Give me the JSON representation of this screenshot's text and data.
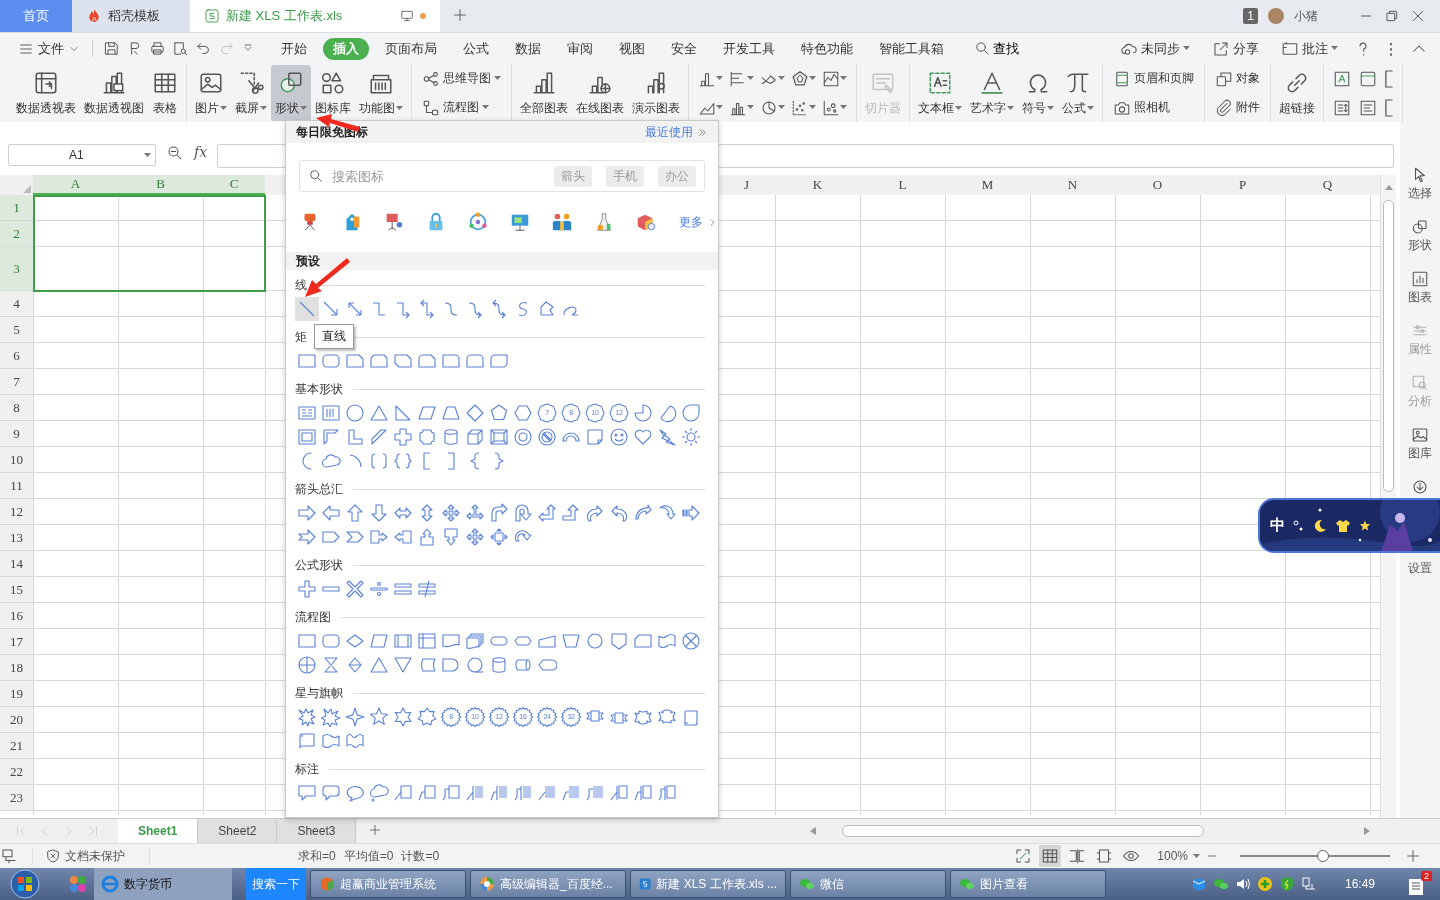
{
  "tabs": [
    {
      "label": "首页",
      "kind": "home",
      "selected": false
    },
    {
      "label": "稻壳模板",
      "kind": "docer",
      "selected": false
    },
    {
      "label": "新建 XLS 工作表.xls",
      "kind": "sheet",
      "selected": true
    }
  ],
  "account": {
    "count": "1",
    "name": "小猪"
  },
  "menu": {
    "file": "文件",
    "tabs": [
      {
        "label": "开始",
        "selected": false
      },
      {
        "label": "插入",
        "selected": true
      },
      {
        "label": "页面布局",
        "selected": false
      },
      {
        "label": "公式",
        "selected": false
      },
      {
        "label": "数据",
        "selected": false
      },
      {
        "label": "审阅",
        "selected": false
      },
      {
        "label": "视图",
        "selected": false
      },
      {
        "label": "安全",
        "selected": false
      },
      {
        "label": "开发工具",
        "selected": false
      },
      {
        "label": "特色功能",
        "selected": false
      },
      {
        "label": "智能工具箱",
        "selected": false
      }
    ],
    "search": "查找",
    "actions": [
      {
        "label": "未同步",
        "dropdown": true
      },
      {
        "label": "分享",
        "dropdown": false
      },
      {
        "label": "批注",
        "dropdown": true
      }
    ]
  },
  "ribbon": [
    {
      "kind": "large",
      "items": [
        {
          "label": "数据透视表",
          "dropdown": false,
          "pressed": false,
          "disabled": false
        },
        {
          "label": "数据透视图",
          "dropdown": false,
          "pressed": false,
          "disabled": false
        },
        {
          "label": "表格",
          "dropdown": false,
          "pressed": false,
          "disabled": false
        }
      ]
    },
    {
      "kind": "large",
      "items": [
        {
          "label": "图片",
          "dropdown": true,
          "pressed": false,
          "disabled": false
        },
        {
          "label": "截屏",
          "dropdown": true,
          "pressed": false,
          "disabled": false
        },
        {
          "label": "形状",
          "dropdown": true,
          "pressed": true,
          "disabled": false
        },
        {
          "label": "图标库",
          "dropdown": false,
          "pressed": false,
          "disabled": false
        },
        {
          "label": "功能图",
          "dropdown": true,
          "pressed": false,
          "disabled": false
        }
      ]
    },
    {
      "kind": "stack",
      "items": [
        {
          "label": "思维导图",
          "dropdown": true,
          "pressed": false,
          "disabled": false
        },
        {
          "label": "流程图",
          "dropdown": true,
          "pressed": false,
          "disabled": false
        }
      ]
    },
    {
      "kind": "large",
      "items": [
        {
          "label": "全部图表",
          "dropdown": false,
          "pressed": false,
          "disabled": false
        },
        {
          "label": "在线图表",
          "dropdown": false,
          "pressed": false,
          "disabled": false
        },
        {
          "label": "演示图表",
          "dropdown": false,
          "pressed": false,
          "disabled": false
        }
      ]
    },
    {
      "kind": "icon-grid",
      "items": [
        {
          "dropdown": true,
          "pressed": false,
          "disabled": false
        },
        {
          "dropdown": true,
          "pressed": false,
          "disabled": false
        },
        {
          "dropdown": true,
          "pressed": false,
          "disabled": false
        },
        {
          "dropdown": true,
          "pressed": false,
          "disabled": false
        },
        {
          "dropdown": true,
          "pressed": false,
          "disabled": false
        },
        {
          "dropdown": true,
          "pressed": false,
          "disabled": false
        },
        {
          "dropdown": true,
          "pressed": false,
          "disabled": false
        },
        {
          "dropdown": true,
          "pressed": false,
          "disabled": false
        },
        {
          "dropdown": true,
          "pressed": false,
          "disabled": false
        },
        {
          "dropdown": true,
          "pressed": false,
          "disabled": false
        }
      ]
    },
    {
      "kind": "large",
      "items": [
        {
          "label": "切片器",
          "dropdown": false,
          "pressed": false,
          "disabled": true
        }
      ]
    },
    {
      "kind": "large",
      "items": [
        {
          "label": "文本框",
          "dropdown": true,
          "pressed": false,
          "disabled": false
        },
        {
          "label": "艺术字",
          "dropdown": true,
          "pressed": false,
          "disabled": false
        },
        {
          "label": "符号",
          "dropdown": true,
          "pressed": false,
          "disabled": false
        },
        {
          "label": "公式",
          "dropdown": true,
          "pressed": false,
          "disabled": false
        }
      ]
    },
    {
      "kind": "stack",
      "items": [
        {
          "label": "页眉和页脚",
          "dropdown": false,
          "pressed": false,
          "disabled": false
        },
        {
          "label": "照相机",
          "dropdown": false,
          "pressed": false,
          "disabled": false
        }
      ]
    },
    {
      "kind": "stack",
      "items": [
        {
          "label": "对象",
          "dropdown": false,
          "pressed": false,
          "disabled": false
        },
        {
          "label": "附件",
          "dropdown": false,
          "pressed": false,
          "disabled": false
        }
      ]
    },
    {
      "kind": "large",
      "items": [
        {
          "label": "超链接",
          "dropdown": false,
          "pressed": false,
          "disabled": false
        }
      ]
    },
    {
      "kind": "icon-grid",
      "items": [
        {
          "dropdown": false,
          "pressed": false,
          "disabled": false
        },
        {
          "dropdown": false,
          "pressed": false,
          "disabled": false
        },
        {
          "dropdown": false,
          "pressed": false,
          "disabled": false
        },
        {
          "dropdown": false,
          "pressed": false,
          "disabled": false
        },
        {
          "dropdown": false,
          "pressed": false,
          "disabled": false
        },
        {
          "dropdown": false,
          "pressed": false,
          "disabled": false
        }
      ]
    }
  ],
  "formula_bar": {
    "cell": "A1",
    "fx": "fx"
  },
  "grid": {
    "left_columns": [
      {
        "label": "A",
        "selected": true
      },
      {
        "label": "B",
        "selected": true
      },
      {
        "label": "C",
        "selected": true
      }
    ],
    "right_columns": [
      {
        "label": "J",
        "selected": false
      },
      {
        "label": "K",
        "selected": false
      },
      {
        "label": "L",
        "selected": false
      },
      {
        "label": "M",
        "selected": false
      },
      {
        "label": "N",
        "selected": false
      },
      {
        "label": "O",
        "selected": false
      },
      {
        "label": "P",
        "selected": false
      },
      {
        "label": "Q",
        "selected": false
      }
    ],
    "rows": [
      {
        "label": "1",
        "selected": true
      },
      {
        "label": "2",
        "selected": true
      },
      {
        "label": "3",
        "selected": true
      },
      {
        "label": "4",
        "selected": false
      },
      {
        "label": "5",
        "selected": false
      },
      {
        "label": "6",
        "selected": false
      },
      {
        "label": "7",
        "selected": false
      },
      {
        "label": "8",
        "selected": false
      },
      {
        "label": "9",
        "selected": false
      },
      {
        "label": "10",
        "selected": false
      },
      {
        "label": "11",
        "selected": false
      },
      {
        "label": "12",
        "selected": false
      },
      {
        "label": "13",
        "selected": false
      },
      {
        "label": "14",
        "selected": false
      },
      {
        "label": "15",
        "selected": false
      },
      {
        "label": "16",
        "selected": false
      },
      {
        "label": "17",
        "selected": false
      },
      {
        "label": "18",
        "selected": false
      },
      {
        "label": "19",
        "selected": false
      },
      {
        "label": "20",
        "selected": false
      },
      {
        "label": "21",
        "selected": false
      },
      {
        "label": "22",
        "selected": false
      },
      {
        "label": "23",
        "selected": false
      }
    ]
  },
  "shape_panel": {
    "title": "每日限免图标",
    "recent": "最近使用",
    "search": {
      "placeholder": "搜索图标",
      "tags": [
        "箭头",
        "手机",
        "办公"
      ]
    },
    "more": "更多",
    "presets": "预设",
    "tooltip": "直线",
    "sections": [
      {
        "title": "线",
        "shapes": [
          {
            "kind": "line",
            "selected": true
          },
          {
            "kind": "arrow",
            "selected": false
          },
          {
            "kind": "double-arrow",
            "selected": false
          },
          {
            "kind": "elbow-connector",
            "selected": false
          },
          {
            "kind": "elbow-arrow",
            "selected": false
          },
          {
            "kind": "elbow-double-arrow",
            "selected": false
          },
          {
            "kind": "curved-connector",
            "selected": false
          },
          {
            "kind": "curved-arrow",
            "selected": false
          },
          {
            "kind": "curved-double-arrow",
            "selected": false
          },
          {
            "kind": "s-curve",
            "selected": false
          },
          {
            "kind": "freeform",
            "selected": false
          },
          {
            "kind": "scribble",
            "selected": false
          }
        ]
      },
      {
        "title": "矩",
        "shapes": [
          {
            "kind": "rectangle"
          },
          {
            "kind": "rounded-rectangle"
          },
          {
            "kind": "snip-corner"
          },
          {
            "kind": "snip-same-side"
          },
          {
            "kind": "snip-diagonal"
          },
          {
            "kind": "snip-round"
          },
          {
            "kind": "round-corner"
          },
          {
            "kind": "round-same-side"
          },
          {
            "kind": "round-diagonal"
          }
        ]
      },
      {
        "title": "基本形状",
        "shapes": [
          {
            "kind": "text-box"
          },
          {
            "kind": "vertical-text-box"
          },
          {
            "kind": "oval"
          },
          {
            "kind": "triangle"
          },
          {
            "kind": "right-triangle"
          },
          {
            "kind": "parallelogram"
          },
          {
            "kind": "trapezoid"
          },
          {
            "kind": "diamond"
          },
          {
            "kind": "pentagon"
          },
          {
            "kind": "hexagon"
          },
          {
            "kind": "polygon",
            "label": "7"
          },
          {
            "kind": "polygon",
            "label": "8"
          },
          {
            "kind": "polygon",
            "label": "10"
          },
          {
            "kind": "polygon",
            "label": "12"
          },
          {
            "kind": "pie"
          },
          {
            "kind": "chord"
          },
          {
            "kind": "teardrop"
          },
          {
            "kind": "frame"
          },
          {
            "kind": "half-frame"
          },
          {
            "kind": "l-shape"
          },
          {
            "kind": "diagonal-stripe"
          },
          {
            "kind": "cross"
          },
          {
            "kind": "plaque"
          },
          {
            "kind": "can"
          },
          {
            "kind": "cube"
          },
          {
            "kind": "bevel"
          },
          {
            "kind": "donut"
          },
          {
            "kind": "no-symbol"
          },
          {
            "kind": "block-arc"
          },
          {
            "kind": "folded-corner"
          },
          {
            "kind": "smiley"
          },
          {
            "kind": "heart"
          },
          {
            "kind": "lightning"
          },
          {
            "kind": "sun"
          },
          {
            "kind": "moon"
          },
          {
            "kind": "cloud"
          },
          {
            "kind": "arc"
          },
          {
            "kind": "double-bracket"
          },
          {
            "kind": "double-brace"
          },
          {
            "kind": "left-bracket"
          },
          {
            "kind": "right-bracket"
          },
          {
            "kind": "left-brace"
          },
          {
            "kind": "right-brace"
          }
        ]
      },
      {
        "title": "箭头总汇",
        "shapes": [
          {
            "kind": "right-arrow"
          },
          {
            "kind": "left-arrow"
          },
          {
            "kind": "up-arrow"
          },
          {
            "kind": "down-arrow"
          },
          {
            "kind": "left-right-arrow"
          },
          {
            "kind": "up-down-arrow"
          },
          {
            "kind": "quad-arrow"
          },
          {
            "kind": "left-right-up-arrow"
          },
          {
            "kind": "bent-arrow"
          },
          {
            "kind": "u-turn-arrow"
          },
          {
            "kind": "left-up-arrow"
          },
          {
            "kind": "bent-up-arrow"
          },
          {
            "kind": "curved-right-arrow"
          },
          {
            "kind": "curved-left-arrow"
          },
          {
            "kind": "curved-up-arrow"
          },
          {
            "kind": "curved-down-arrow"
          },
          {
            "kind": "striped-arrow"
          },
          {
            "kind": "notched-arrow"
          },
          {
            "kind": "pentagon-arrow"
          },
          {
            "kind": "chevron"
          },
          {
            "kind": "right-arrow-callout"
          },
          {
            "kind": "left-arrow-callout"
          },
          {
            "kind": "up-arrow-callout"
          },
          {
            "kind": "down-arrow-callout"
          },
          {
            "kind": "quad-arrow"
          },
          {
            "kind": "quad-arrow-callout"
          },
          {
            "kind": "circular-arrow"
          }
        ]
      },
      {
        "title": "公式形状",
        "shapes": [
          {
            "kind": "plus"
          },
          {
            "kind": "minus"
          },
          {
            "kind": "multiply"
          },
          {
            "kind": "divide"
          },
          {
            "kind": "equal"
          },
          {
            "kind": "not-equal"
          }
        ]
      },
      {
        "title": "流程图",
        "shapes": [
          {
            "kind": "process"
          },
          {
            "kind": "alternate-process"
          },
          {
            "kind": "decision"
          },
          {
            "kind": "data"
          },
          {
            "kind": "predefined-process"
          },
          {
            "kind": "internal-storage"
          },
          {
            "kind": "document"
          },
          {
            "kind": "multi-document"
          },
          {
            "kind": "terminator"
          },
          {
            "kind": "preparation"
          },
          {
            "kind": "manual-input"
          },
          {
            "kind": "manual-operation"
          },
          {
            "kind": "connector"
          },
          {
            "kind": "off-page-connector"
          },
          {
            "kind": "card"
          },
          {
            "kind": "punched-tape"
          },
          {
            "kind": "summing-junction"
          },
          {
            "kind": "or-junction"
          },
          {
            "kind": "collate"
          },
          {
            "kind": "sort"
          },
          {
            "kind": "extract"
          },
          {
            "kind": "merge"
          },
          {
            "kind": "stored-data"
          },
          {
            "kind": "delay"
          },
          {
            "kind": "sequential-storage"
          },
          {
            "kind": "magnetic-disk"
          },
          {
            "kind": "direct-access-storage"
          },
          {
            "kind": "display"
          }
        ]
      },
      {
        "title": "星与旗帜",
        "shapes": [
          {
            "kind": "explosion"
          },
          {
            "kind": "explosion-alt"
          },
          {
            "kind": "four-point-star"
          },
          {
            "kind": "five-point-star"
          },
          {
            "kind": "six-point-star"
          },
          {
            "kind": "seven-point-star"
          },
          {
            "kind": "seal",
            "label": "8"
          },
          {
            "kind": "seal",
            "label": "10"
          },
          {
            "kind": "seal",
            "label": "12"
          },
          {
            "kind": "seal",
            "label": "16"
          },
          {
            "kind": "seal",
            "label": "24"
          },
          {
            "kind": "seal",
            "label": "32"
          },
          {
            "kind": "ribbon-down"
          },
          {
            "kind": "ribbon-up"
          },
          {
            "kind": "curved-ribbon-down"
          },
          {
            "kind": "curved-ribbon-up"
          },
          {
            "kind": "vertical-scroll"
          },
          {
            "kind": "horizontal-scroll"
          },
          {
            "kind": "wave"
          },
          {
            "kind": "double-wave"
          }
        ]
      },
      {
        "title": "标注",
        "shapes": [
          {
            "kind": "rectangle-callout"
          },
          {
            "kind": "rounded-callout"
          },
          {
            "kind": "oval-callout"
          },
          {
            "kind": "cloud-callout"
          },
          {
            "kind": "line-callout"
          },
          {
            "kind": "bent-line-callout"
          },
          {
            "kind": "double-bent-callout"
          },
          {
            "kind": "accent-callout"
          },
          {
            "kind": "accent-bent-callout"
          },
          {
            "kind": "accent-double-callout"
          },
          {
            "kind": "filled-callout"
          },
          {
            "kind": "filled-bent-callout"
          },
          {
            "kind": "filled-double-callout"
          },
          {
            "kind": "border-callout"
          },
          {
            "kind": "border-bent-callout"
          },
          {
            "kind": "border-double-callout"
          }
        ]
      }
    ]
  },
  "sidebar": [
    {
      "kind": "button",
      "label": "选择",
      "disabled": false
    },
    {
      "kind": "button",
      "label": "形状",
      "disabled": false
    },
    {
      "kind": "button",
      "label": "图表",
      "disabled": false
    },
    {
      "kind": "button",
      "label": "属性",
      "disabled": true
    },
    {
      "kind": "button",
      "label": "分析",
      "disabled": true
    },
    {
      "kind": "button",
      "label": "图库",
      "disabled": false
    },
    {
      "kind": "icon",
      "disabled": false
    },
    {
      "kind": "label",
      "label": "设置",
      "disabled": false
    }
  ],
  "ime": {
    "mode": "中"
  },
  "sheets": [
    {
      "label": "Sheet1",
      "selected": true
    },
    {
      "label": "Sheet2",
      "selected": false
    },
    {
      "label": "Sheet3",
      "selected": false
    }
  ],
  "status": {
    "protect": "文档未保护",
    "stats": [
      "求和=0",
      "平均值=0",
      "计数=0"
    ],
    "views": [
      {
        "selected": false
      },
      {
        "selected": true
      },
      {
        "selected": false
      },
      {
        "selected": false
      },
      {
        "selected": false
      }
    ],
    "zoom": "100%",
    "zoom_slider": {
      "level": 0.55
    }
  },
  "taskbar": {
    "pinned": "数字货币",
    "search": "搜索一下",
    "windows": [
      {
        "label": "超赢商业管理系统"
      },
      {
        "label": "高级编辑器_百度经..."
      },
      {
        "label": "新建 XLS 工作表.xls ..."
      },
      {
        "label": "微信"
      },
      {
        "label": "图片查看"
      }
    ],
    "clock": "16:49",
    "notifications": "2"
  }
}
